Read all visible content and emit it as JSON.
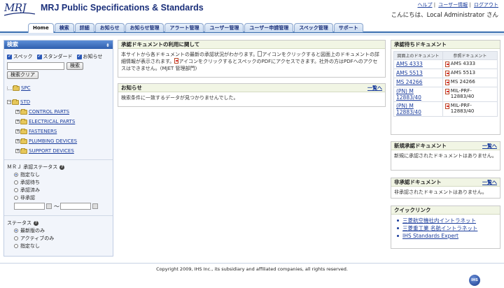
{
  "header": {
    "logo_text": "MRJ",
    "title": "MRJ Public Specifications & Standards",
    "links": [
      "ヘルプ",
      "ユーザー情報",
      "ログアウト"
    ],
    "link_sep": "|",
    "greeting": "こんにちは、Local Administrator さん"
  },
  "tabs": [
    "Home",
    "検索",
    "詳細",
    "お知らせ",
    "お知らせ管理",
    "アラート管理",
    "ユーザー管理",
    "ユーザー申請管理",
    "スペック管理",
    "サポート"
  ],
  "sidebar": {
    "title": "検索",
    "pin": "⇟",
    "checkboxes": [
      "スペック",
      "スタンダード",
      "お知らせ"
    ],
    "search_button": "検索",
    "clear_button": "検索クリア",
    "tree": {
      "spc": "SPC",
      "std": "STD",
      "children": [
        "CONTROL PARTS",
        "ELECTRICAL PARTS",
        "FASTENERS",
        "PLUMBING DEVICES",
        "SUPPORT DEVICES"
      ]
    },
    "status_label": "ＭＲＪ 承認ステータス",
    "status_options": [
      "指定なし",
      "承認待ち",
      "承認済み",
      "非承認"
    ],
    "tilde": "～",
    "status2_label": "ステータス",
    "status2_options": [
      "最新版のみ",
      "アクティブのみ",
      "指定なし"
    ],
    "help": "?"
  },
  "center": {
    "about": {
      "title": "承認ドキュメントの利用に関して",
      "line1a": "本サイトから各ドキュメントの最新の承認状況がわかります。",
      "line1b": "アイコンをクリックすると図面上のドキュメントの詳細情報が表示されます。",
      "line2a": "アイコンをクリックするとスペックのPDFにアクセスできます。社外の方はPDFへのアクセスはできません。(MJET 管理部門)"
    },
    "news": {
      "title": "お知らせ",
      "more": "一覧へ",
      "body": "検索条件に一致するデータが見つかりませんでした。"
    }
  },
  "right": {
    "pending": {
      "title": "承認待ちドキュメント",
      "col1": "図面上のドキュメント",
      "col2": "参照ドキュメント",
      "rows": [
        {
          "doc": "AMS 4333",
          "ref": "AMS 4333"
        },
        {
          "doc": "AMS 5513",
          "ref": "AMS 5513"
        },
        {
          "doc": "MS 24266",
          "ref": "MS 24266"
        },
        {
          "doc": "(PN) M 12883/40",
          "ref": "MIL-PRF-12883/40"
        },
        {
          "doc": "(PN) M 12883/40",
          "ref": "MIL-PRF-12883/40"
        }
      ]
    },
    "new_approved": {
      "title": "新規承認ドキュメント",
      "more": "一覧へ",
      "body": "新規に承認されたドキュメントはありません。"
    },
    "unapproved": {
      "title": "非承認ドキュメント",
      "more": "一覧へ",
      "body": "非承認されたドキュメントはありません。"
    },
    "quicklinks": {
      "title": "クイックリンク",
      "items": [
        "三菱航空機社内イントラネット",
        "三菱重工業 名航イントラネット",
        "IHS Standards Expert"
      ]
    }
  },
  "footer": {
    "copyright": "Copyright 2009, IHS Inc., its subsidiary and affiliated companies, all rights reserved.",
    "ihs": "IHS"
  },
  "colors": {
    "accent": "#1a2f7a",
    "tab_border": "#3b6fb0",
    "panel_head": "#f1f5e4"
  }
}
